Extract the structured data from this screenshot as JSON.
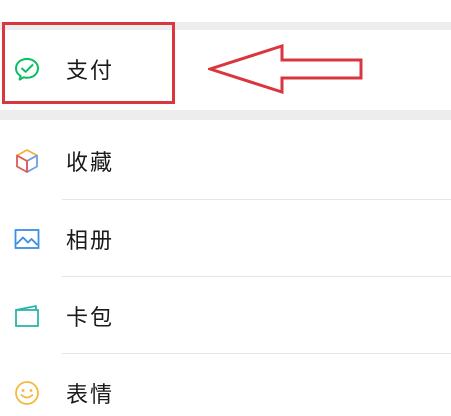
{
  "menu": {
    "pay": {
      "label": "支付",
      "icon": "pay-check-icon"
    },
    "items": [
      {
        "id": "favorites",
        "label": "收藏",
        "icon": "cube-icon"
      },
      {
        "id": "album",
        "label": "相册",
        "icon": "picture-icon"
      },
      {
        "id": "cards",
        "label": "卡包",
        "icon": "card-wallet-icon"
      },
      {
        "id": "stickers",
        "label": "表情",
        "icon": "smiley-icon"
      }
    ]
  },
  "annotation": {
    "highlight_color": "#d9363e",
    "arrow_color": "#d9363e"
  },
  "colors": {
    "background": "#ededed",
    "row_background": "#ffffff",
    "text": "#1a1a1a",
    "pay_icon": "#07c160",
    "favorites_icon_top": "#f2b33d",
    "favorites_icon_side": "#6d9ee8",
    "favorites_icon_bottom": "#e05a5a",
    "album_icon": "#3a8ee6",
    "cards_icon": "#2bb5a8",
    "stickers_icon": "#f5b83d"
  }
}
